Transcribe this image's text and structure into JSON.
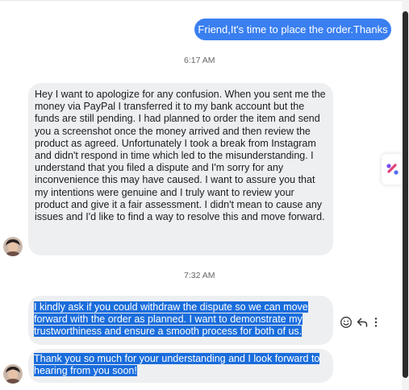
{
  "thread": {
    "outgoing_message": "Friend,It's time to place the order.Thanks",
    "timestamp_1": "6:17 AM",
    "incoming_message_1": "Hey I want to apologize for any confusion. When you sent me the money via PayPal I transferred it to my bank account but the funds are still pending. I had planned to order the item and send you a screenshot once the money arrived and then review the product as agreed. Unfortunately I took a break from Instagram and didn't respond in time which led to the misunderstanding. I understand that you filed a dispute and I'm sorry for any inconvenience this may have caused. I want to assure you that my intentions were genuine and I truly want to review your product and give it a fair assessment. I didn't mean to cause any issues and I'd like to find a way to resolve this and move forward.",
    "timestamp_2": "7:32 AM",
    "incoming_message_2": "I kindly ask if you could withdraw the dispute so we can move forward with the order as planned. I want to demonstrate my trustworthiness and ensure a smooth process for both of us.",
    "incoming_message_3": "Thank you so much for your understanding and I look forward to hearing from you soon!"
  },
  "message_actions": {
    "icons": [
      "emoji-react-icon",
      "reply-icon",
      "more-options-icon"
    ]
  },
  "colors": {
    "outgoing_bubble": "#3a7ff0",
    "incoming_bubble": "#eeeff1",
    "selection": "#1a6ddc"
  }
}
